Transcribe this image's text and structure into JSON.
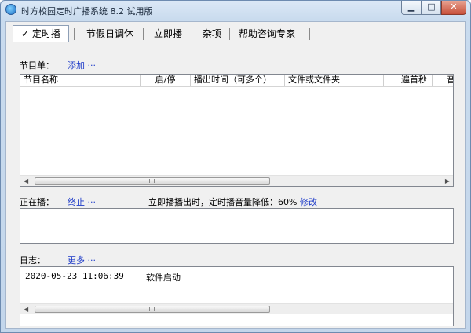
{
  "window": {
    "title": "时方校园定时广播系统 8.2 试用版"
  },
  "tabs": [
    {
      "label": "✓ 定时播"
    },
    {
      "label": "节假日调休"
    },
    {
      "label": "立即播"
    },
    {
      "label": "杂项"
    },
    {
      "label": "帮助咨询专家"
    }
  ],
  "program": {
    "label": "节目单：",
    "add_link": "添加 ···",
    "columns": [
      "节目名称",
      "启/停",
      "播出时间（可多个）",
      "文件或文件夹",
      "遍首秒",
      "音"
    ]
  },
  "now_playing": {
    "label": "正在播：",
    "stop_link": "终止 ···",
    "info": "立即播播出时，定时播音量降低：60%",
    "modify_link": "修改"
  },
  "log": {
    "label": "日志：",
    "more_link": "更多 ···",
    "entries": [
      {
        "time": "2020-05-23 11:06:39",
        "message": "软件启动"
      }
    ]
  }
}
